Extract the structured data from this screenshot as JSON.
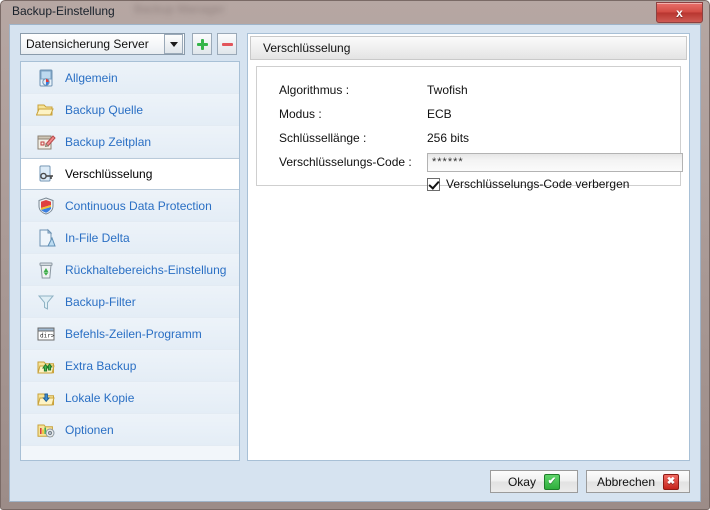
{
  "window": {
    "title": "Backup-Einstellung",
    "background_window_title": "Backup Manager",
    "close_label": "x"
  },
  "selector": {
    "value": "Datensicherung Server",
    "add_label": "+",
    "remove_label": "-"
  },
  "sidebar": {
    "items": [
      {
        "label": "Allgemein",
        "icon": "document-chart-icon",
        "selected": false
      },
      {
        "label": "Backup Quelle",
        "icon": "folder-open-icon",
        "selected": false
      },
      {
        "label": "Backup Zeitplan",
        "icon": "calendar-pencil-icon",
        "selected": false
      },
      {
        "label": "Verschlüsselung",
        "icon": "key-lock-icon",
        "selected": true
      },
      {
        "label": "Continuous Data Protection",
        "icon": "shield-icon",
        "selected": false
      },
      {
        "label": "In-File Delta",
        "icon": "page-delta-icon",
        "selected": false
      },
      {
        "label": "Rückhaltebereichs-Einstellung",
        "icon": "recycle-bin-icon",
        "selected": false
      },
      {
        "label": "Backup-Filter",
        "icon": "funnel-icon",
        "selected": false
      },
      {
        "label": "Befehls-Zeilen-Programm",
        "icon": "command-prompt-icon",
        "selected": false
      },
      {
        "label": "Extra Backup",
        "icon": "folder-up-arrows-icon",
        "selected": false
      },
      {
        "label": "Lokale Kopie",
        "icon": "folder-down-arrow-icon",
        "selected": false
      },
      {
        "label": "Optionen",
        "icon": "folder-gear-icon",
        "selected": false
      }
    ]
  },
  "panel": {
    "title": "Verschlüsselung",
    "fields": {
      "algorithm_label": "Algorithmus :",
      "algorithm_value": "Twofish",
      "mode_label": "Modus :",
      "mode_value": "ECB",
      "keylength_label": "Schlüssellänge :",
      "keylength_value": "256 bits",
      "password_label": "Verschlüsselungs-Code :",
      "password_value": "******",
      "hide_password_label": "Verschlüsselungs-Code verbergen",
      "hide_password_checked": true
    }
  },
  "buttons": {
    "ok_label": "Okay",
    "ok_badge": "✔",
    "cancel_label": "Abbrechen",
    "cancel_badge": "✖"
  },
  "colors": {
    "link_blue": "#2a6fc4",
    "dialog_bg": "#d6e3f0",
    "accent_green": "#35b54a",
    "accent_red": "#e2555b"
  }
}
